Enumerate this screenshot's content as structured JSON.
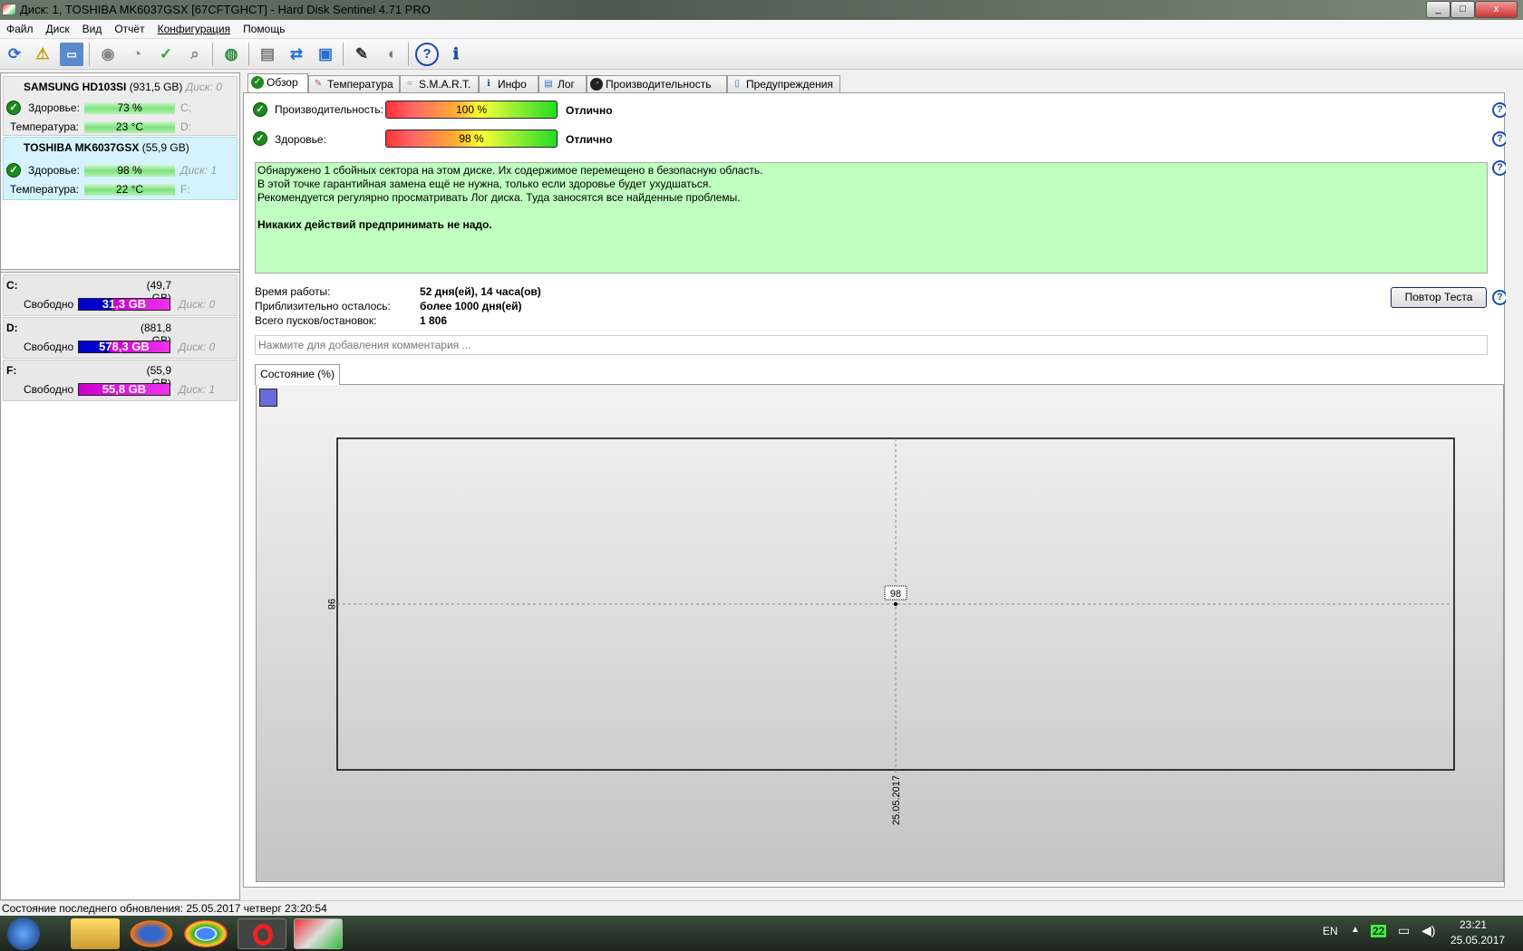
{
  "window": {
    "title": "Диск: 1, TOSHIBA MK6037GSX [67CFTGHCT]  -  Hard Disk Sentinel 4.71 PRO",
    "min": "_",
    "max": "□",
    "close": "x"
  },
  "menu": [
    "Файл",
    "Диск",
    "Вид",
    "Отчёт",
    "Конфигурация",
    "Помощь"
  ],
  "toolbar": {
    "icons": [
      "refresh-icon",
      "alert-icon",
      "disk-icon",
      "disk-test-icon",
      "disk-timer-icon",
      "disk-ok-icon",
      "disk-search-icon",
      "globe-icon",
      "report-icon",
      "sync-icon",
      "network-icon",
      "tools-icon",
      "speaker-icon",
      "help-icon",
      "info-icon"
    ]
  },
  "disks": [
    {
      "name": "SAMSUNG HD103SI",
      "size": "(931,5 GB)",
      "disk": "Диск: 0",
      "health_label": "Здоровье:",
      "health": "73 %",
      "temp_label": "Температура:",
      "temp": "23 °C",
      "vol1": "C;",
      "vol2": "D:"
    },
    {
      "name": "TOSHIBA MK6037GSX",
      "size": "(55,9 GB)",
      "disk": "Диск: 1",
      "health_label": "Здоровье:",
      "health": "98 %",
      "temp_label": "Температура:",
      "temp": "22 °C",
      "vol1": "F:"
    }
  ],
  "volumes": [
    {
      "letter": "C:",
      "size": "(49,7 GB)",
      "free_label": "Свободно",
      "free": "31,3 GB",
      "used_fraction": 0.37,
      "disk": "Диск: 0"
    },
    {
      "letter": "D:",
      "size": "(881,8 GB)",
      "free_label": "Свободно",
      "free": "578,3 GB",
      "used_fraction": 0.34,
      "disk": "Диск: 0"
    },
    {
      "letter": "F:",
      "size": "(55,9 GB)",
      "free_label": "Свободно",
      "free": "55,8 GB",
      "used_fraction": 0.0,
      "disk": "Диск: 1"
    }
  ],
  "tabs": [
    "Обзор",
    "Температура",
    "S.M.A.R.T.",
    "Инфо",
    "Лог",
    "Производительность",
    "Предупреждения"
  ],
  "overview": {
    "perf_label": "Производительность:",
    "perf_value": "100 %",
    "perf_percent": 100,
    "perf_status": "Отлично",
    "health_label": "Здоровье:",
    "health_value": "98 %",
    "health_percent": 98,
    "health_status": "Отлично",
    "message": [
      "Обнаружено 1 сбойных сектора на этом диске. Их содержимое перемещено в безопасную область.",
      "В этой точке гарантийная замена ещё не нужна, только если здоровье будет ухудшаться.",
      "Рекомендуется регулярно просматривать Лог диска. Туда заносятся все найденные проблемы."
    ],
    "message_bold": "Никаких действий предпринимать не надо.",
    "uptime_label": "Время работы:",
    "uptime": "52 дня(ей), 14 часа(ов)",
    "remaining_label": "Приблизительно осталось:",
    "remaining": "более 1000 дня(ей)",
    "starts_label": "Всего пусков/остановок:",
    "starts": "1 806",
    "retest": "Повтор Теста",
    "comment_placeholder": "Нажмите для добавления комментария ...",
    "subtab": "Состояние (%)"
  },
  "chart_data": {
    "type": "line",
    "x": [
      "25.05.2017"
    ],
    "values": [
      98
    ],
    "ytick_labels": [
      "98"
    ],
    "xtick_labels": [
      "25.05.2017"
    ],
    "data_labels": [
      "98"
    ],
    "grid": true
  },
  "statusbar": "Состояние последнего обновления: 25.05.2017 четверг 23:20:54",
  "tray": {
    "lang": "EN",
    "badge": "22",
    "time": "23:21",
    "date": "25.05.2017"
  },
  "colors": {
    "accent": "#1d8a1d",
    "msg_bg": "#bfffbf",
    "selected_disk": "#d4f3fc"
  }
}
